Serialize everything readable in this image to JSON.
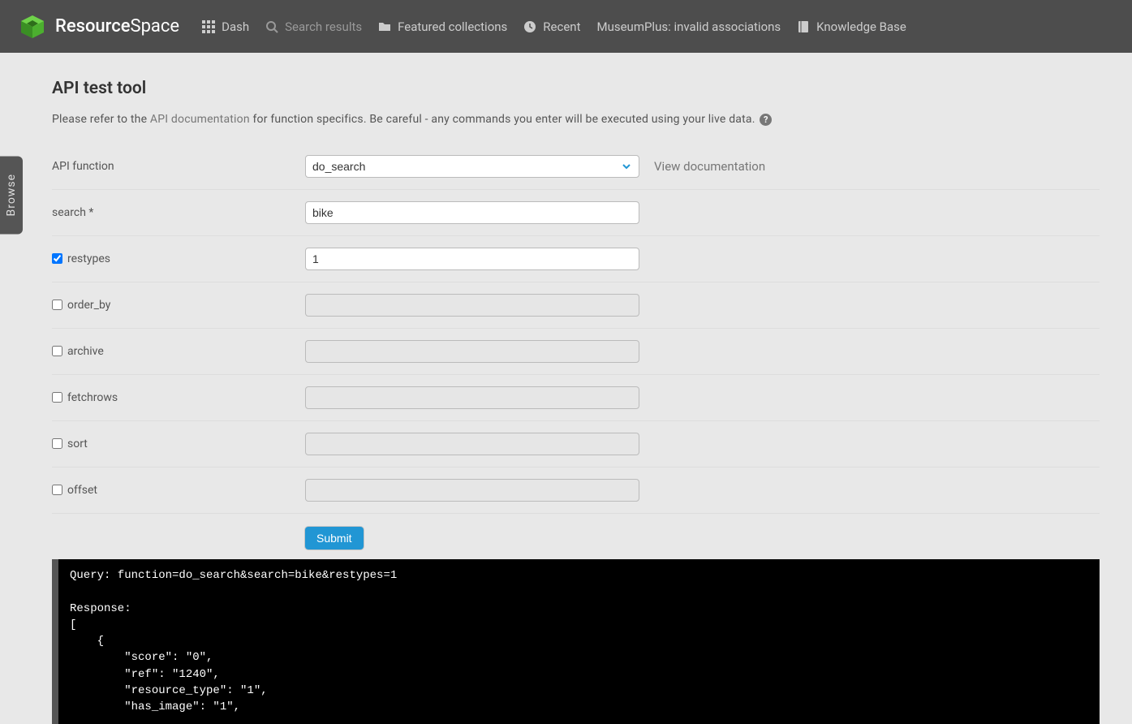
{
  "brand": {
    "name_bold": "Resource",
    "name_light": "Space"
  },
  "nav": {
    "dash": "Dash",
    "search_results": "Search results",
    "featured": "Featured collections",
    "recent": "Recent",
    "museumplus": "MuseumPlus: invalid associations",
    "kb": "Knowledge Base"
  },
  "browse_tab": "Browse",
  "page": {
    "title": "API test tool",
    "intro_prefix": "Please refer to the ",
    "intro_link": "API documentation",
    "intro_suffix": " for function specifics. Be careful - any commands you enter will be executed using your live data."
  },
  "form": {
    "api_function_label": "API function",
    "api_function_value": "do_search",
    "view_doc": "View documentation",
    "params": [
      {
        "label": "search *",
        "checkbox": false,
        "value": "bike",
        "enabled": true,
        "checked": false
      },
      {
        "label": "restypes",
        "checkbox": true,
        "value": "1",
        "enabled": true,
        "checked": true
      },
      {
        "label": "order_by",
        "checkbox": true,
        "value": "",
        "enabled": false,
        "checked": false
      },
      {
        "label": "archive",
        "checkbox": true,
        "value": "",
        "enabled": false,
        "checked": false
      },
      {
        "label": "fetchrows",
        "checkbox": true,
        "value": "",
        "enabled": false,
        "checked": false
      },
      {
        "label": "sort",
        "checkbox": true,
        "value": "",
        "enabled": false,
        "checked": false
      },
      {
        "label": "offset",
        "checkbox": true,
        "value": "",
        "enabled": false,
        "checked": false
      }
    ],
    "submit": "Submit"
  },
  "output": "Query: function=do_search&search=bike&restypes=1\n\nResponse:\n[\n    {\n        \"score\": \"0\",\n        \"ref\": \"1240\",\n        \"resource_type\": \"1\",\n        \"has_image\": \"1\","
}
